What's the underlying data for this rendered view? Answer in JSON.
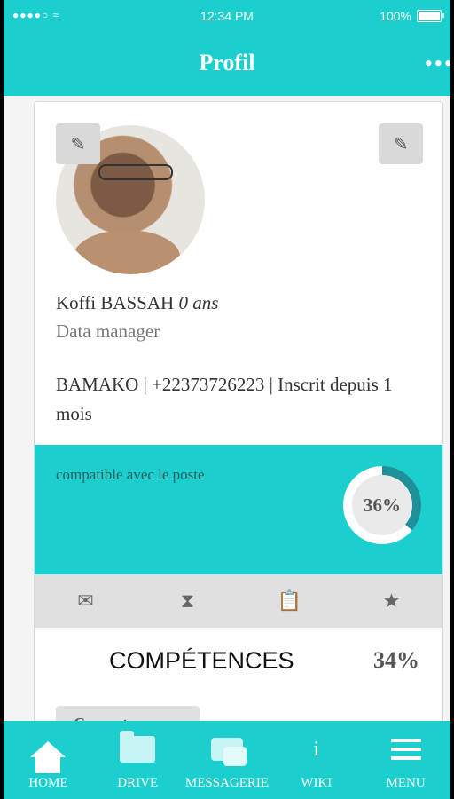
{
  "status_bar": {
    "signal": "●●●●○ ≈",
    "time": "12:34 PM",
    "battery": "100%"
  },
  "nav": {
    "title": "Profil",
    "more_icon": "ellipsis-icon"
  },
  "profile": {
    "name": "Koffi BASSAH",
    "age": "0 ans",
    "role": "Data manager",
    "info": "BAMAKO | +22373726223 | Inscrit depuis 1 mois"
  },
  "compatibility": {
    "label": "compatible avec le poste",
    "percent_text": "36%",
    "value": 0.36,
    "accent": "#1ccfcf"
  },
  "icon_row": [
    "mail-icon",
    "hourglass-icon",
    "clipboard-icon",
    "star-icon"
  ],
  "competences": {
    "title": "COMPÉTENCES",
    "percent": "34%",
    "tag": "Competence"
  },
  "tabbar": [
    {
      "label": "HOME",
      "icon": "home-icon"
    },
    {
      "label": "DRIVE",
      "icon": "folder-icon"
    },
    {
      "label": "MESSAGERIE",
      "icon": "chat-icon"
    },
    {
      "label": "WIKI",
      "icon": "info-icon"
    },
    {
      "label": "MENU",
      "icon": "menu-icon"
    }
  ]
}
